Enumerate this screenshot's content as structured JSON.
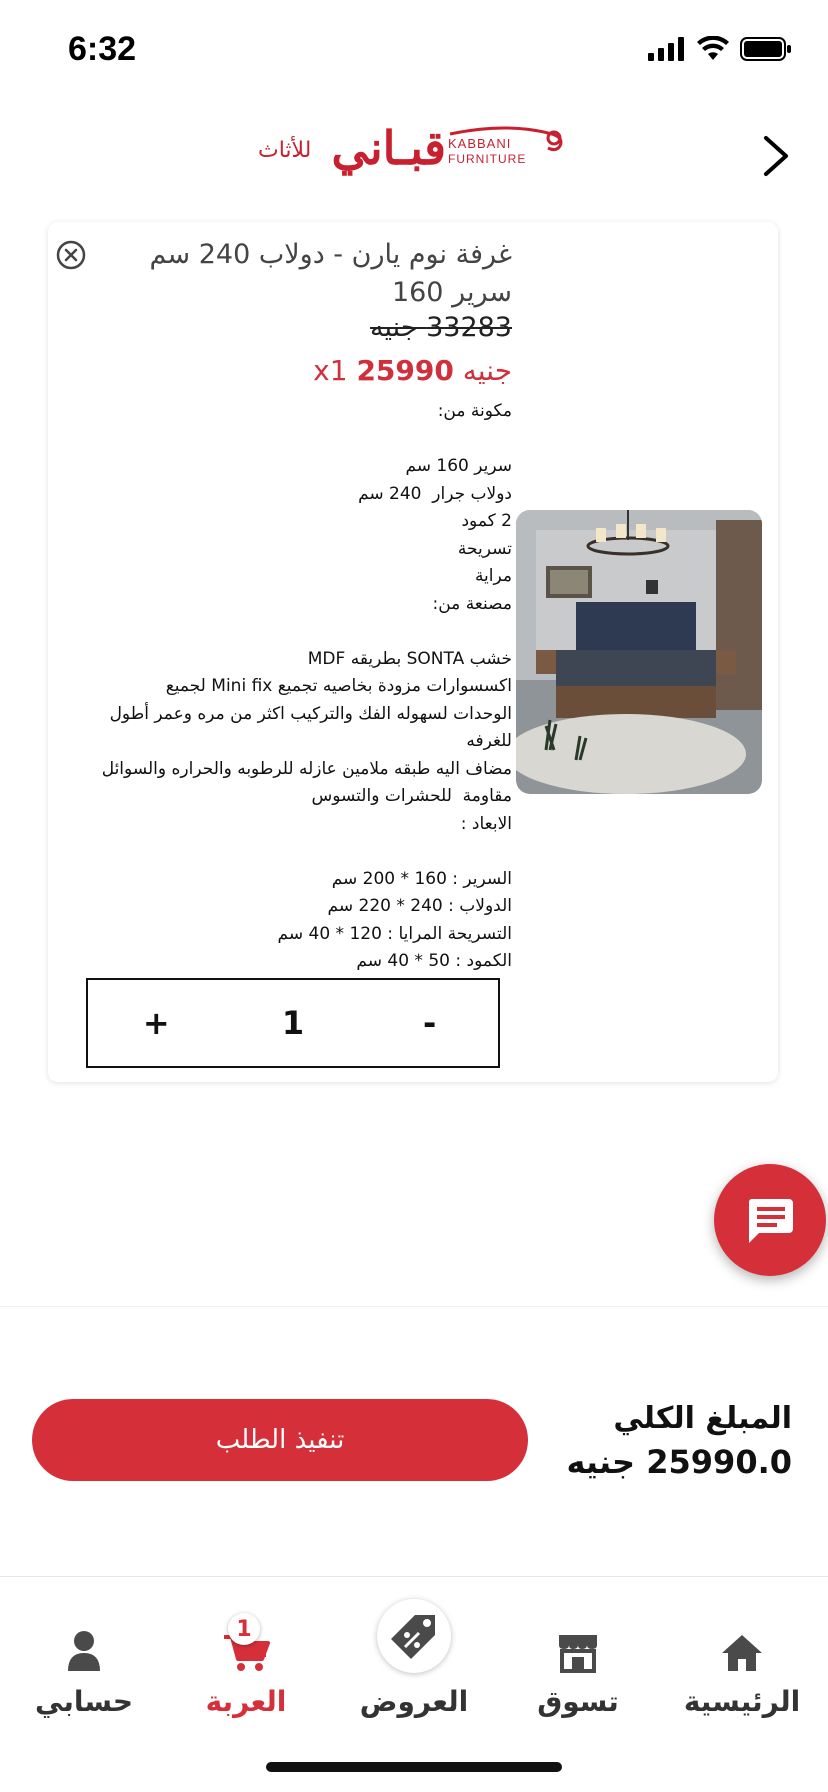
{
  "status_bar": {
    "time": "6:32"
  },
  "header": {
    "logo_ar": "قبـاني",
    "logo_ar_small": "للأثاث",
    "logo_en_1": "KABBANI",
    "logo_en_2": "FURNITURE"
  },
  "cart_item": {
    "title": "غرفة نوم يارن - دولاب 240 سم سرير 160",
    "old_price": "33283 جنيه",
    "new_price_currency": "جنيه",
    "new_price_amount": "25990",
    "quantity_suffix": "x1",
    "description_lines": [
      "مكونة من:",
      "",
      "سرير 160 سم",
      "دولاب جرار  240 سم",
      "2 كمود",
      "تسريحة",
      "مراية",
      "مصنعة من:",
      "",
      "خشب SONTA بطريقه MDF",
      "اكسسوارات مزودة بخاصيه تجميع Mini fix لجميع",
      "الوحدات لسهوله الفك والتركيب اكثر من مره وعمر أطول",
      "للغرفه",
      "مضاف اليه طبقه ملامين عازله للرطوبه والحراره والسوائل",
      "مقاومة  للحشرات والتسوس",
      "الابعاد :",
      "",
      "السرير : 160 * 200 سم",
      "الدولاب : 240 * 220 سم",
      "التسريحة المرايا : 120 * 40 سم",
      "الكمود : 50 * 40 سم"
    ],
    "qty_plus": "+",
    "qty_value": "1",
    "qty_minus": "-"
  },
  "summary": {
    "total_label": "المبلغ الكلي",
    "total_value": "25990.0 جنيه",
    "checkout_label": "تنفيذ الطلب"
  },
  "tabs": [
    {
      "label": "حسابي",
      "icon": "person-icon"
    },
    {
      "label": "العربة",
      "icon": "cart-icon",
      "badge": "1"
    },
    {
      "label": "العروض",
      "icon": "offers-tag-icon"
    },
    {
      "label": "تسوق",
      "icon": "store-icon"
    },
    {
      "label": "الرئيسية",
      "icon": "home-icon"
    }
  ],
  "colors": {
    "brand": "#d52f3a",
    "text": "#111111"
  }
}
